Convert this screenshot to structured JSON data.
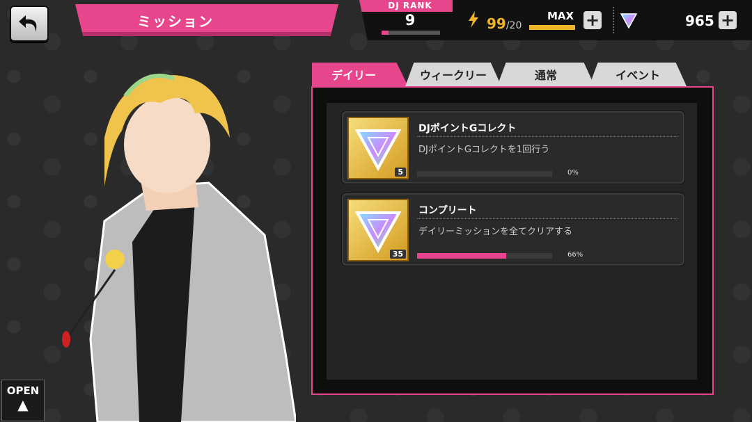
{
  "header": {
    "title": "ミッション",
    "dj_rank_label": "DJ RANK",
    "dj_rank_value": "9",
    "rank_progress": 0.12,
    "stamina_current": "99",
    "stamina_max": "/20",
    "stamina_max_label": "MAX",
    "gem_count": "965"
  },
  "tabs": [
    {
      "label": "デイリー",
      "active": true
    },
    {
      "label": "ウィークリー",
      "active": false
    },
    {
      "label": "通常",
      "active": false
    },
    {
      "label": "イベント",
      "active": false
    }
  ],
  "missions": [
    {
      "title": "DJポイントGコレクト",
      "description": "DJポイントGコレクトを1回行う",
      "reward_count": "5",
      "progress": 0,
      "percent": "0%"
    },
    {
      "title": "コンプリート",
      "description": "デイリーミッションを全てクリアする",
      "reward_count": "35",
      "progress": 66,
      "percent": "66%"
    }
  ],
  "open_button": {
    "label": "OPEN",
    "arrow": "▲"
  },
  "colors": {
    "accent": "#e8468c",
    "gold": "#f0b429",
    "panel": "#242424"
  }
}
